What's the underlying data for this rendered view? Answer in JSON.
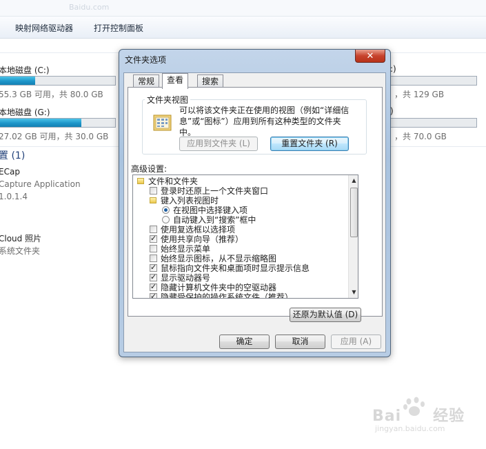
{
  "explorer": {
    "faded_top_text": "Baidu.com",
    "toolbar": {
      "map_drive": "映射网络驱动器",
      "open_control_panel": "打开控制面板"
    },
    "drives": [
      {
        "label": "本地磁盘 (C:)",
        "info": "55.3 GB 可用，共 80.0 GB",
        "used_fraction": 0.31
      },
      {
        "label": "本地磁盘 (G:)",
        "info": "27.02 GB 可用，共 30.0 GB",
        "used_fraction": 0.71
      },
      {
        "label": ":)",
        "info": "，共 129 GB",
        "used_fraction": 0.0
      },
      {
        "label": ")",
        "info": "，共 70.0 GB",
        "used_fraction": 0.0
      }
    ],
    "group_header": "置 (1)",
    "items": [
      {
        "name": "ECap",
        "sub1": "Capture Application",
        "sub2": "1.0.1.4"
      },
      {
        "name": "Cloud 照片",
        "sub1": "系统文件夹"
      }
    ]
  },
  "dialog": {
    "title": "文件夹选项",
    "tabs": [
      "常规",
      "查看",
      "搜索"
    ],
    "folder_views": {
      "title": "文件夹视图",
      "description": "可以将该文件夹正在使用的视图（例如“详细信息”或“图标”）应用到所有这种类型的文件夹中。",
      "apply_button": "应用到文件夹 (L)",
      "reset_button": "重置文件夹 (R)"
    },
    "advanced_label": "高级设置:",
    "tree": [
      {
        "kind": "folder",
        "level": 0,
        "label": "文件和文件夹"
      },
      {
        "kind": "check",
        "level": 1,
        "checked": false,
        "label": "登录时还原上一个文件夹窗口"
      },
      {
        "kind": "folder",
        "level": 1,
        "label": "键入列表视图时"
      },
      {
        "kind": "radio",
        "level": 2,
        "checked": true,
        "label": "在视图中选择键入项"
      },
      {
        "kind": "radio",
        "level": 2,
        "checked": false,
        "label": "自动键入到“搜索”框中"
      },
      {
        "kind": "check",
        "level": 1,
        "checked": false,
        "label": "使用复选框以选择项"
      },
      {
        "kind": "check",
        "level": 1,
        "checked": true,
        "label": "使用共享向导（推荐）"
      },
      {
        "kind": "check",
        "level": 1,
        "checked": false,
        "label": "始终显示菜单"
      },
      {
        "kind": "check",
        "level": 1,
        "checked": false,
        "label": "始终显示图标，从不显示缩略图"
      },
      {
        "kind": "check",
        "level": 1,
        "checked": true,
        "label": "鼠标指向文件夹和桌面项时显示提示信息"
      },
      {
        "kind": "check",
        "level": 1,
        "checked": true,
        "label": "显示驱动器号"
      },
      {
        "kind": "check",
        "level": 1,
        "checked": true,
        "label": "隐藏计算机文件夹中的空驱动器"
      },
      {
        "kind": "check",
        "level": 1,
        "checked": true,
        "label": "隐藏受保护的操作系统文件（推荐）"
      }
    ],
    "restore_defaults": "还原为默认值 (D)",
    "ok": "确定",
    "cancel": "取消",
    "apply": "应用 (A)",
    "close_symbol": "✕",
    "scroll_up": "▲",
    "scroll_down": "▼"
  },
  "watermark": {
    "brand": "Bai",
    "brand2": "经验",
    "url": "jingyan.baidu.com"
  }
}
